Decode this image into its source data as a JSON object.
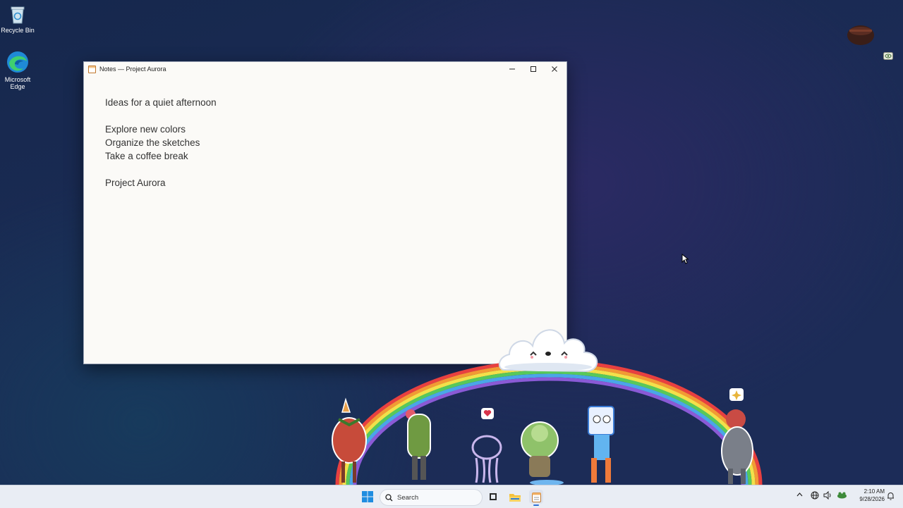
{
  "desktop": {
    "icons": [
      {
        "label": "Recycle Bin",
        "icon": "recycle-bin-icon"
      },
      {
        "label": "Microsoft\nEdge",
        "icon": "edge-icon"
      }
    ]
  },
  "window": {
    "title": "Notes — Project Aurora",
    "app_icon": "notepad-icon",
    "buttons": {
      "minimize": "—",
      "maximize": "☐",
      "close": "✕"
    },
    "lines": [
      "Ideas for a quiet afternoon",
      "",
      "Explore new colors",
      "Organize the sketches",
      "Take a coffee break",
      "",
      "Project Aurora"
    ]
  },
  "taskbar": {
    "search_placeholder": "Search",
    "pinned": [
      "start-icon",
      "search-icon",
      "task-view-icon",
      "file-explorer-icon",
      "notepad-icon"
    ],
    "tray": {
      "chevron": "^",
      "time": "2:10 AM",
      "date": "9/28/2026"
    }
  },
  "colors": {
    "accent": "#2d6fd6",
    "desktop_bg": "#1b2b55",
    "window_bg": "#fbfaf7"
  }
}
